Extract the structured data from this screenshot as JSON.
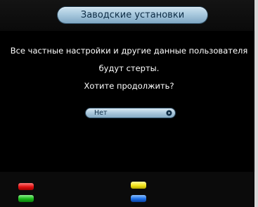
{
  "dialog": {
    "title": "Заводские установки",
    "message_lines": [
      "Все частные настройки и другие данные пользователя",
      "будут стерты.",
      "Хотите продолжить?"
    ],
    "button": {
      "label": "Нет",
      "icon": "arrow-right-icon"
    }
  },
  "footer": {
    "color_keys": [
      "red",
      "yellow",
      "green",
      "blue"
    ]
  },
  "colors": {
    "accent": "#a9c9de",
    "text_dark": "#0d2c45",
    "background": "#000000"
  }
}
